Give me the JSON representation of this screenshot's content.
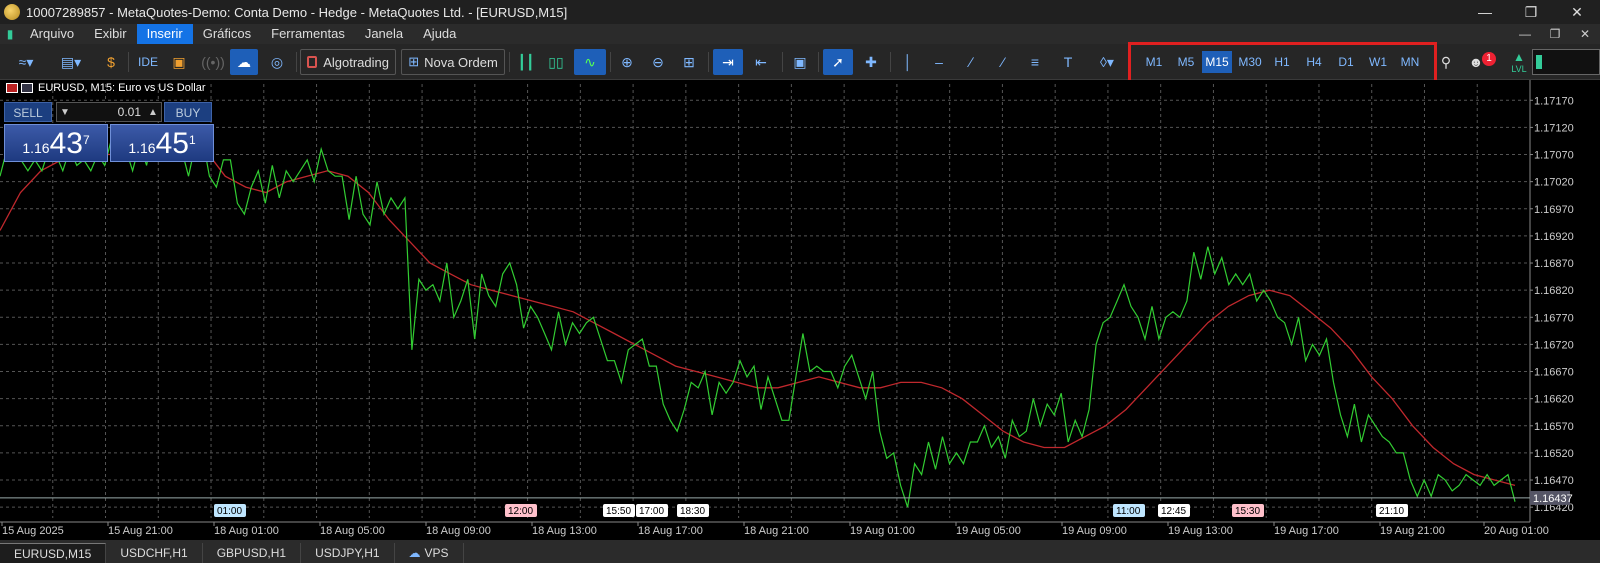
{
  "window": {
    "title": "10007289857 - MetaQuotes-Demo: Conta Demo - Hedge - MetaQuotes Ltd. - [EURUSD,M15]",
    "controls": [
      "—",
      "❐",
      "✕"
    ]
  },
  "menu": {
    "items": [
      "Arquivo",
      "Exibir",
      "Inserir",
      "Gráficos",
      "Ferramentas",
      "Janela",
      "Ajuda"
    ],
    "active": "Inserir"
  },
  "toolbar": {
    "algotrading": "Algotrading",
    "nova_ordem": "Nova Ordem",
    "ide": "IDE",
    "timeframes": [
      "M1",
      "M5",
      "M15",
      "M30",
      "H1",
      "H4",
      "D1",
      "W1",
      "MN"
    ],
    "selected_timeframe": "M15",
    "notification_count": "1",
    "signal_label": "LVL",
    "icons": [
      "line-chart-icon",
      "indicators-icon",
      "dollar-icon",
      "ide-icon",
      "market-bag-icon",
      "signal-icon",
      "cloud-icon",
      "globe-plus-icon",
      "algotrading-icon",
      "new-order-icon",
      "bar-chart-icon",
      "candlestick-icon",
      "line-icon",
      "zoom-in-icon",
      "zoom-out-icon",
      "grid-icon",
      "autoscroll-icon",
      "chart-shift-icon",
      "screenshot-icon",
      "cursor-icon",
      "crosshair-icon",
      "vertical-line-icon",
      "horizontal-line-icon",
      "trendline-icon",
      "channel-icon",
      "fibonacci-icon",
      "text-icon",
      "shapes-icon",
      "search-icon",
      "notifications-icon",
      "signal-strength-icon"
    ]
  },
  "chart": {
    "label": "EURUSD, M15:  Euro vs US Dollar",
    "trade": {
      "sell_label": "SELL",
      "buy_label": "BUY",
      "lot": "0.01",
      "sell_prefix": "1.16",
      "sell_big": "43",
      "sell_sup": "7",
      "buy_prefix": "1.16",
      "buy_big": "45",
      "buy_sup": "1"
    },
    "colors": {
      "price_line": "#32cd32",
      "ma_line": "#c0282d",
      "grid": "#555555",
      "background": "#000000"
    }
  },
  "chart_data": {
    "type": "line",
    "symbol": "EURUSD",
    "timeframe": "M15",
    "ylim": [
      1.164,
      1.172
    ],
    "y_ticks": [
      "1.17170",
      "1.17120",
      "1.17070",
      "1.17020",
      "1.16970",
      "1.16920",
      "1.16870",
      "1.16820",
      "1.16770",
      "1.16720",
      "1.16670",
      "1.16620",
      "1.16570",
      "1.16520",
      "1.16470",
      "1.16420"
    ],
    "current_price": "1.16437",
    "x_labels": [
      "15 Aug 2025",
      "15 Aug 21:00",
      "18 Aug 01:00",
      "18 Aug 05:00",
      "18 Aug 09:00",
      "18 Aug 13:00",
      "18 Aug 17:00",
      "18 Aug 21:00",
      "19 Aug 01:00",
      "19 Aug 05:00",
      "19 Aug 09:00",
      "19 Aug 13:00",
      "19 Aug 17:00",
      "19 Aug 21:00",
      "20 Aug 01:00"
    ],
    "time_markers": [
      {
        "label": "01:00",
        "color": "#bfe6ff"
      },
      {
        "label": "12:00",
        "color": "#ffc0cb"
      },
      {
        "label": "15:50",
        "color": "#ffffff"
      },
      {
        "label": "17:00",
        "color": "#ffffff"
      },
      {
        "label": "18:30",
        "color": "#ffffff"
      },
      {
        "label": "11:00",
        "color": "#bfe6ff"
      },
      {
        "label": "12:45",
        "color": "#ffffff"
      },
      {
        "label": "15:30",
        "color": "#ffc0cb"
      },
      {
        "label": "21:10",
        "color": "#ffffff"
      }
    ],
    "series": [
      {
        "values": [
          1.1703,
          1.1708,
          1.1711,
          1.1706,
          1.1704,
          1.1706,
          1.1704,
          1.1708,
          1.1707,
          1.1704,
          1.1708,
          1.1705,
          1.1706,
          1.1704,
          1.1707,
          1.1705,
          1.171,
          1.1706,
          1.1708,
          1.1704,
          1.1709,
          1.1705,
          1.1712,
          1.1708,
          1.1706,
          1.171,
          1.1708,
          1.1703,
          1.1709,
          1.171,
          1.1703,
          1.1701,
          1.1706,
          1.1706,
          1.1698,
          1.1696,
          1.1701,
          1.1704,
          1.1698,
          1.1705,
          1.1699,
          1.1704,
          1.1702,
          1.1704,
          1.1706,
          1.1702,
          1.1708,
          1.1704,
          1.1703,
          1.1703,
          1.1695,
          1.1703,
          1.1696,
          1.1694,
          1.1702,
          1.1696,
          1.1699,
          1.1697,
          1.1699,
          1.1671,
          1.1684,
          1.1682,
          1.1683,
          1.168,
          1.1687,
          1.1677,
          1.168,
          1.1684,
          1.1673,
          1.1685,
          1.1681,
          1.1679,
          1.1685,
          1.1687,
          1.1683,
          1.1675,
          1.1679,
          1.1677,
          1.1674,
          1.1671,
          1.1678,
          1.1672,
          1.1676,
          1.1674,
          1.1676,
          1.1677,
          1.1673,
          1.1669,
          1.1669,
          1.1665,
          1.1671,
          1.1672,
          1.1673,
          1.1668,
          1.1668,
          1.1661,
          1.1658,
          1.1656,
          1.166,
          1.1665,
          1.1664,
          1.1667,
          1.1659,
          1.1665,
          1.1663,
          1.1665,
          1.1669,
          1.1666,
          1.1668,
          1.166,
          1.1666,
          1.1662,
          1.1658,
          1.1658,
          1.1666,
          1.1674,
          1.1667,
          1.1668,
          1.1667,
          1.1667,
          1.1664,
          1.1668,
          1.167,
          1.1666,
          1.1662,
          1.1667,
          1.1656,
          1.1651,
          1.1652,
          1.1646,
          1.1642,
          1.165,
          1.1648,
          1.1654,
          1.1649,
          1.1655,
          1.165,
          1.1652,
          1.165,
          1.1654,
          1.1654,
          1.1657,
          1.1653,
          1.1655,
          1.1651,
          1.1658,
          1.1655,
          1.1656,
          1.1662,
          1.1657,
          1.1661,
          1.1659,
          1.1663,
          1.1654,
          1.1658,
          1.1655,
          1.166,
          1.1672,
          1.1676,
          1.1677,
          1.168,
          1.1683,
          1.1679,
          1.1677,
          1.1673,
          1.1679,
          1.1673,
          1.1677,
          1.1678,
          1.1677,
          1.168,
          1.1689,
          1.1684,
          1.169,
          1.1685,
          1.1688,
          1.1683,
          1.1685,
          1.1683,
          1.1685,
          1.168,
          1.1682,
          1.168,
          1.1677,
          1.1676,
          1.1672,
          1.1677,
          1.1669,
          1.1672,
          1.167,
          1.1673,
          1.1665,
          1.1659,
          1.1655,
          1.1661,
          1.1654,
          1.1659,
          1.1657,
          1.1655,
          1.1654,
          1.1652,
          1.1652,
          1.1647,
          1.1644,
          1.1647,
          1.1644,
          1.1648,
          1.1647,
          1.1645,
          1.1646,
          1.1648,
          1.1647,
          1.1646,
          1.1648,
          1.1646,
          1.1647,
          1.1648,
          1.1643
        ]
      },
      {
        "values": [
          1.1693,
          1.17,
          1.1704,
          1.1706,
          1.1707,
          1.1707,
          1.1707,
          1.1707,
          1.1708,
          1.1709,
          1.1708,
          1.1703,
          1.1701,
          1.17,
          1.1702,
          1.1703,
          1.1704,
          1.1703,
          1.17,
          1.1695,
          1.1691,
          1.1687,
          1.1685,
          1.1683,
          1.1682,
          1.1681,
          1.168,
          1.1679,
          1.1678,
          1.1676,
          1.1674,
          1.1672,
          1.167,
          1.1668,
          1.1667,
          1.1666,
          1.1665,
          1.1664,
          1.1664,
          1.1665,
          1.1666,
          1.1665,
          1.1664,
          1.1664,
          1.1665,
          1.1665,
          1.1664,
          1.1662,
          1.1659,
          1.1656,
          1.1654,
          1.1653,
          1.1653,
          1.1655,
          1.1657,
          1.166,
          1.1664,
          1.1668,
          1.1672,
          1.1676,
          1.1679,
          1.1681,
          1.1682,
          1.1681,
          1.1678,
          1.1675,
          1.1671,
          1.1666,
          1.1662,
          1.1657,
          1.1653,
          1.165,
          1.1648,
          1.1647,
          1.1646
        ]
      }
    ]
  },
  "tabs": [
    "EURUSD,M15",
    "USDCHF,H1",
    "GBPUSD,H1",
    "USDJPY,H1",
    "VPS"
  ],
  "active_tab": "EURUSD,M15"
}
